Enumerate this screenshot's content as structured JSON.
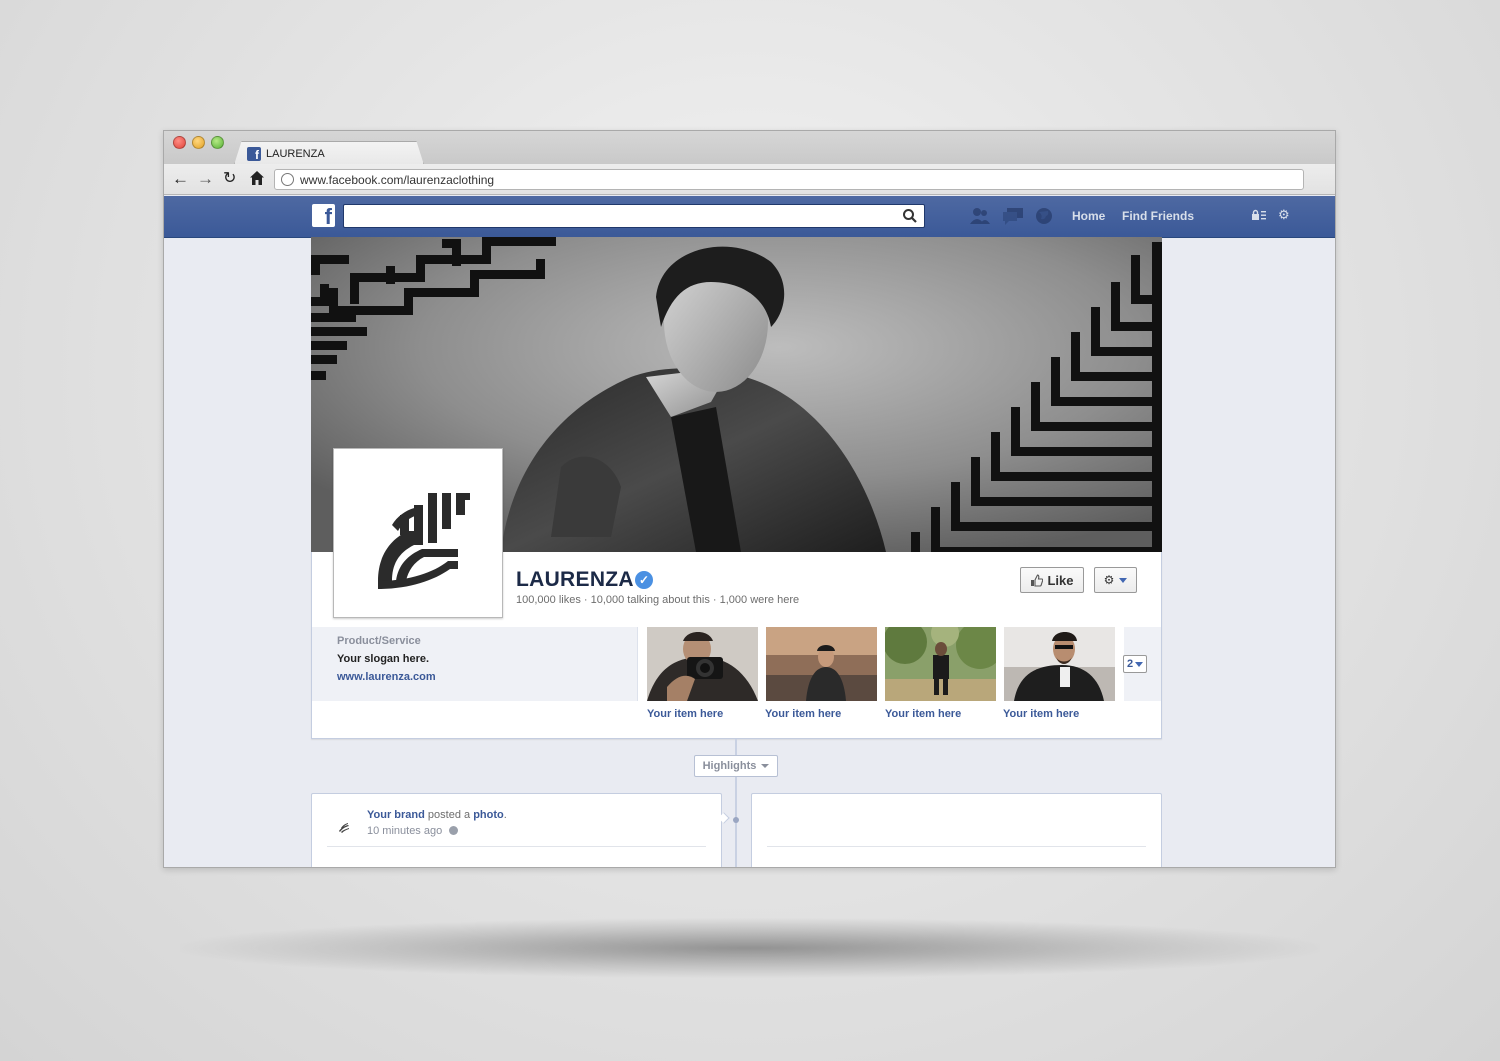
{
  "browser": {
    "tab_title": "LAURENZA",
    "url": "www.facebook.com/laurenzaclothing"
  },
  "fb_header": {
    "nav_home": "Home",
    "nav_find_friends": "Find Friends",
    "brand_color": "#3b5998"
  },
  "profile": {
    "name": "LAURENZA",
    "stats": "100,000 likes · 10,000 talking about this · 1,000 were here",
    "like_label": "Like"
  },
  "about": {
    "category": "Product/Service",
    "slogan": "Your slogan here.",
    "website": "www.laurenza.com"
  },
  "apps": {
    "items": [
      {
        "label": "Your item here"
      },
      {
        "label": "Your item here"
      },
      {
        "label": "Your item here"
      },
      {
        "label": "Your item here"
      }
    ],
    "more_count": "2"
  },
  "timeline": {
    "highlights_label": "Highlights"
  },
  "post": {
    "author": "Your brand",
    "action": " posted a ",
    "object": "photo",
    "punct": ".",
    "time": "10 minutes ago"
  }
}
